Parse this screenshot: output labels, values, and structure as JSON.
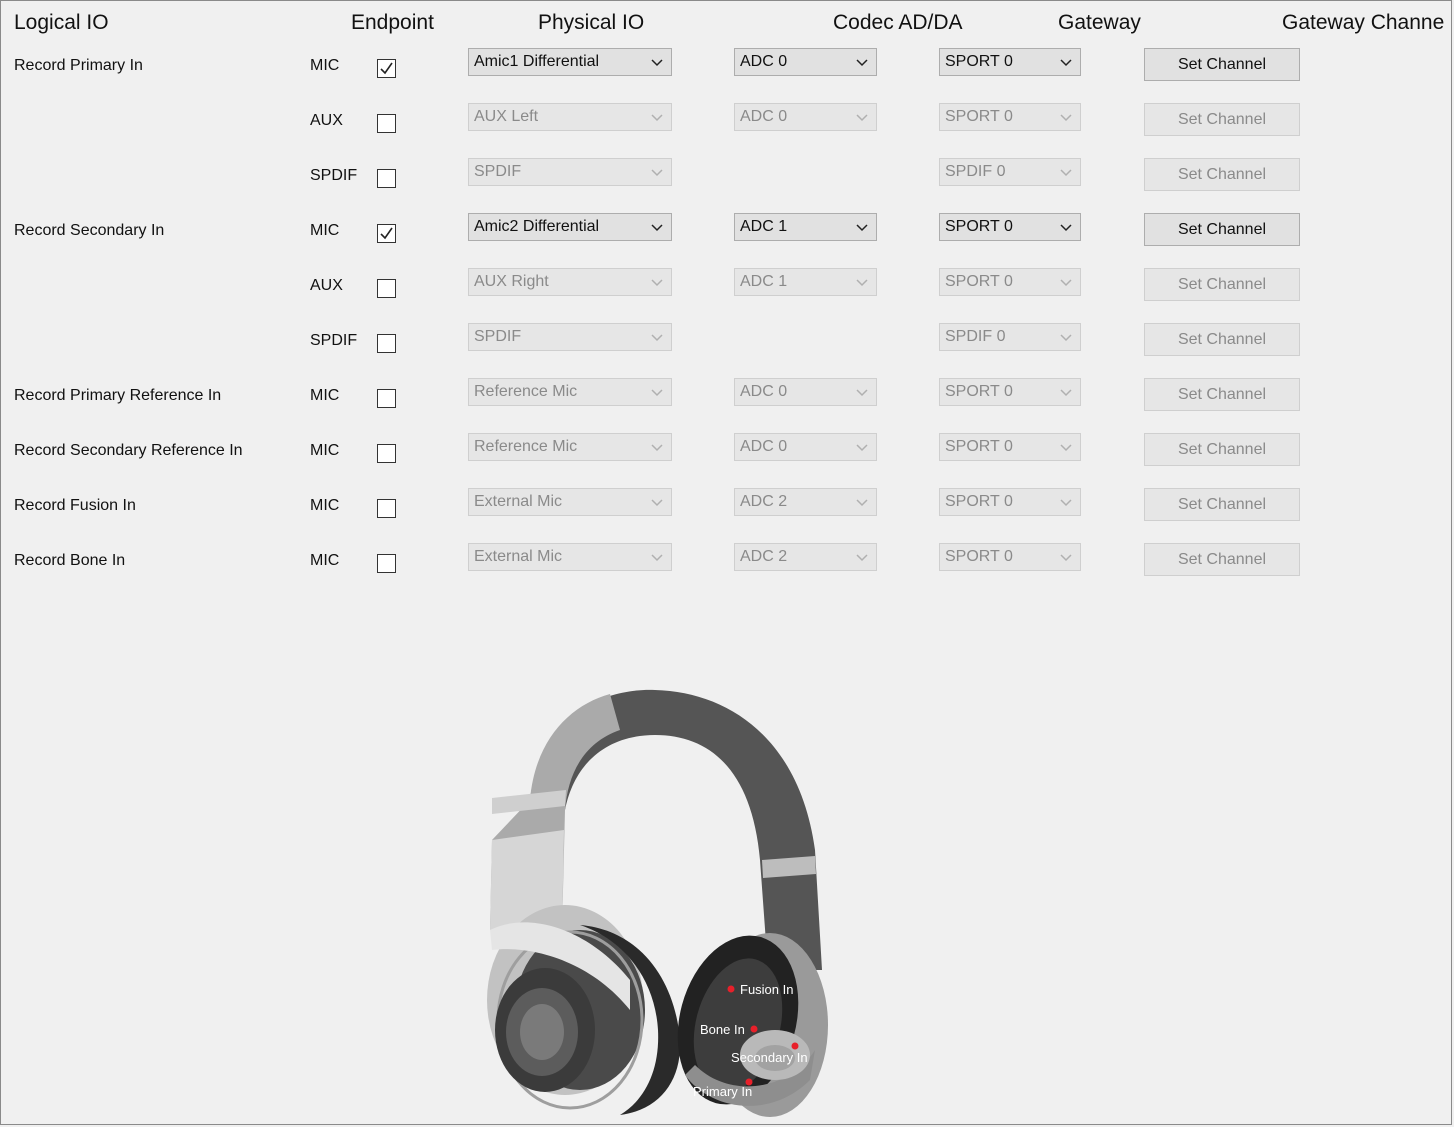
{
  "headers": {
    "logical_io": "Logical IO",
    "endpoint": "Endpoint",
    "physical_io": "Physical IO",
    "codec": "Codec AD/DA",
    "gateway": "Gateway",
    "gateway_channel": "Gateway Channe"
  },
  "rows": [
    {
      "logical": "Record Primary In",
      "endpoint": "MIC",
      "checked": true,
      "physical": "Amic1 Differential",
      "codec": "ADC 0",
      "gateway": "SPORT 0",
      "button": "Set Channel",
      "enabled": true
    },
    {
      "logical": "",
      "endpoint": "AUX",
      "checked": false,
      "physical": "AUX Left",
      "codec": "ADC 0",
      "gateway": "SPORT 0",
      "button": "Set Channel",
      "enabled": false
    },
    {
      "logical": "",
      "endpoint": "SPDIF",
      "checked": false,
      "physical": "SPDIF",
      "codec": "",
      "gateway": "SPDIF 0",
      "button": "Set Channel",
      "enabled": false
    },
    {
      "logical": "Record Secondary In",
      "endpoint": "MIC",
      "checked": true,
      "physical": "Amic2 Differential",
      "codec": "ADC 1",
      "gateway": "SPORT 0",
      "button": "Set Channel",
      "enabled": true
    },
    {
      "logical": "",
      "endpoint": "AUX",
      "checked": false,
      "physical": "AUX Right",
      "codec": "ADC 1",
      "gateway": "SPORT 0",
      "button": "Set Channel",
      "enabled": false
    },
    {
      "logical": "",
      "endpoint": "SPDIF",
      "checked": false,
      "physical": "SPDIF",
      "codec": "",
      "gateway": "SPDIF 0",
      "button": "Set Channel",
      "enabled": false
    },
    {
      "logical": "Record Primary Reference In",
      "endpoint": "MIC",
      "checked": false,
      "physical": "Reference Mic",
      "codec": "ADC 0",
      "gateway": "SPORT 0",
      "button": "Set Channel",
      "enabled": false
    },
    {
      "logical": "Record Secondary Reference In",
      "endpoint": "MIC",
      "checked": false,
      "physical": "Reference Mic",
      "codec": "ADC 0",
      "gateway": "SPORT 0",
      "button": "Set Channel",
      "enabled": false
    },
    {
      "logical": "Record Fusion In",
      "endpoint": "MIC",
      "checked": false,
      "physical": "External Mic",
      "codec": "ADC 2",
      "gateway": "SPORT 0",
      "button": "Set Channel",
      "enabled": false
    },
    {
      "logical": "Record Bone In",
      "endpoint": "MIC",
      "checked": false,
      "physical": "External Mic",
      "codec": "ADC 2",
      "gateway": "SPORT 0",
      "button": "Set Channel",
      "enabled": false
    }
  ],
  "illustration": {
    "fusion": "Fusion In",
    "bone": "Bone In",
    "secondary": "Secondary In",
    "primary": "Primary In",
    "dot_color": "#e8202a"
  }
}
